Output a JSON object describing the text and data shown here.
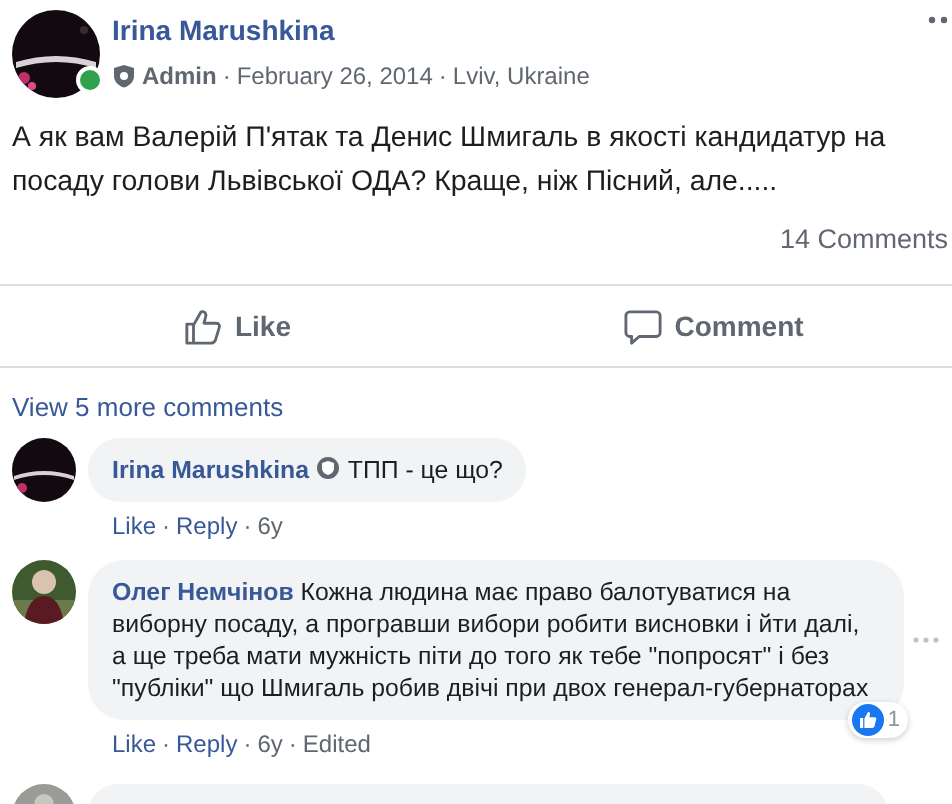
{
  "post": {
    "author": "Irina Marushkina",
    "online": true,
    "role": "Admin",
    "date": "February 26, 2014",
    "location": "Lviv, Ukraine",
    "text": "А як вам Валерій П'ятак та Денис Шмигаль в якості кандидатур на посаду голови Львівської ОДА? Краще, ніж Пісний, але.....",
    "comments_count": "14 Comments"
  },
  "separator": "·",
  "actions": [
    {
      "kind": "like",
      "label": "Like"
    },
    {
      "kind": "comment",
      "label": "Comment"
    }
  ],
  "view_more": "View 5 more comments",
  "comments": [
    {
      "author": "Irina Marushkina",
      "admin_badge": true,
      "text": "ТПП - це що?",
      "links": [
        "Like",
        "Reply"
      ],
      "time": "6y"
    },
    {
      "author": "Олег Немчінов",
      "admin_badge": false,
      "text": "Кожна людина має право балотуватися на виборну посаду, а програвши вибори робити висновки і йти далі, а ще треба мати мужність піти до того як тебе \"попросят\" і без \"публіки\" що Шмигаль робив двічі при двох генерал-губернаторах",
      "links": [
        "Like",
        "Reply"
      ],
      "time": "6y",
      "edited": "Edited",
      "reactions": "1"
    }
  ]
}
